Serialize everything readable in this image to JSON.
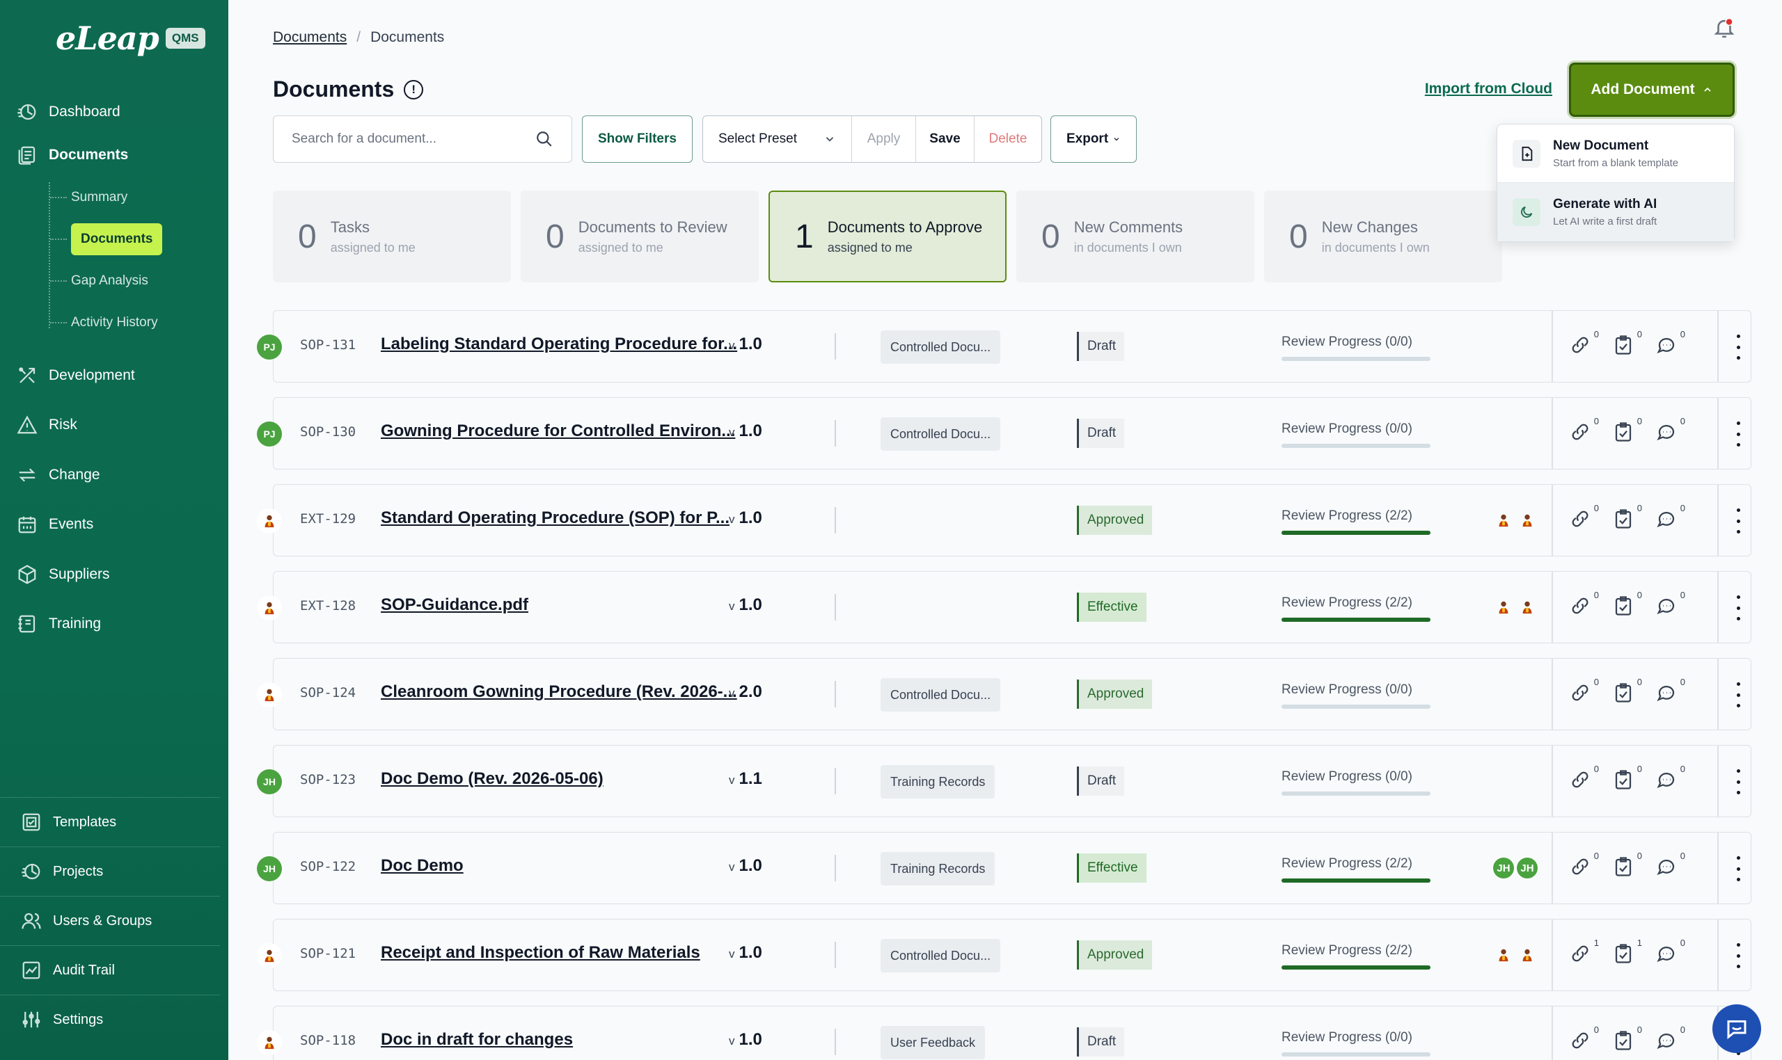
{
  "sidebar": {
    "logo_text": "eLeap",
    "logo_badge": "QMS",
    "nav": [
      {
        "label": "Dashboard",
        "icon": "dashboard-icon"
      },
      {
        "label": "Documents",
        "icon": "documents-icon"
      },
      {
        "label": "Development",
        "icon": "development-icon"
      },
      {
        "label": "Risk",
        "icon": "risk-icon"
      },
      {
        "label": "Change",
        "icon": "change-icon"
      },
      {
        "label": "Events",
        "icon": "calendar-icon"
      },
      {
        "label": "Suppliers",
        "icon": "box-icon"
      },
      {
        "label": "Training",
        "icon": "training-icon"
      }
    ],
    "subnav": [
      {
        "label": "Summary"
      },
      {
        "label": "Documents",
        "active": true
      },
      {
        "label": "Gap Analysis"
      },
      {
        "label": "Activity History"
      }
    ],
    "bottom": [
      {
        "label": "Templates",
        "icon": "templates-icon"
      },
      {
        "label": "Projects",
        "icon": "projects-icon"
      },
      {
        "label": "Users & Groups",
        "icon": "users-icon"
      },
      {
        "label": "Audit Trail",
        "icon": "audit-icon"
      },
      {
        "label": "Settings",
        "icon": "settings-icon"
      }
    ]
  },
  "breadcrumb": {
    "first": "Documents",
    "sep": "/",
    "second": "Documents"
  },
  "page_title": "Documents",
  "import_label": "Import from Cloud",
  "add_label": "Add Document",
  "search_placeholder": "Search for a document...",
  "toolbar": {
    "filters": "Show Filters",
    "preset": "Select Preset",
    "apply": "Apply",
    "save": "Save",
    "delete": "Delete",
    "export": "Export"
  },
  "stats": [
    {
      "num": "0",
      "label": "Tasks",
      "sub": "assigned to me",
      "active": false
    },
    {
      "num": "0",
      "label": "Documents to Review",
      "sub": "assigned to me",
      "active": false
    },
    {
      "num": "1",
      "label": "Documents to Approve",
      "sub": "assigned to me",
      "active": true
    },
    {
      "num": "0",
      "label": "New Comments",
      "sub": "in documents I own",
      "active": false
    },
    {
      "num": "0",
      "label": "New Changes",
      "sub": "in documents I own",
      "active": false
    }
  ],
  "dropdown": [
    {
      "title": "New Document",
      "sub": "Start from a blank template"
    },
    {
      "title": "Generate with AI",
      "sub": "Let AI write a first draft"
    }
  ],
  "rows": [
    {
      "owner": "PJ",
      "id": "SOP-131",
      "title": "Labeling Standard Operating Procedure for...",
      "ver_prefix": "v",
      "ver": "1.0",
      "cat": "Controlled Docu...",
      "status": "Draft",
      "review": "Review Progress (0/0)",
      "progress": 0,
      "reviewers": [],
      "links": "0",
      "tasks": "0",
      "comments": "0"
    },
    {
      "owner": "PJ",
      "id": "SOP-130",
      "title": "Gowning Procedure for Controlled Environ...",
      "ver_prefix": "v",
      "ver": "1.0",
      "cat": "Controlled Docu...",
      "status": "Draft",
      "review": "Review Progress (0/0)",
      "progress": 0,
      "reviewers": [],
      "links": "0",
      "tasks": "0",
      "comments": "0"
    },
    {
      "owner": "",
      "id": "EXT-129",
      "title": "Standard Operating Procedure (SOP) for P...",
      "ver_prefix": "v",
      "ver": "1.0",
      "cat": "",
      "status": "Approved",
      "review": "Review Progress (2/2)",
      "progress": 1,
      "reviewers": [
        "",
        ""
      ],
      "links": "0",
      "tasks": "0",
      "comments": "0"
    },
    {
      "owner": "",
      "id": "EXT-128",
      "title": "SOP-Guidance.pdf",
      "ver_prefix": "v",
      "ver": "1.0",
      "cat": "",
      "status": "Effective",
      "review": "Review Progress (2/2)",
      "progress": 1,
      "reviewers": [
        "",
        ""
      ],
      "links": "0",
      "tasks": "0",
      "comments": "0"
    },
    {
      "owner": "",
      "id": "SOP-124",
      "title": "Cleanroom Gowning Procedure (Rev. 2026-...",
      "ver_prefix": "v",
      "ver": "2.0",
      "cat": "Controlled Docu...",
      "status": "Approved",
      "review": "Review Progress (0/0)",
      "progress": 0,
      "reviewers": [],
      "links": "0",
      "tasks": "0",
      "comments": "0"
    },
    {
      "owner": "JH",
      "id": "SOP-123",
      "title": "Doc Demo (Rev. 2026-05-06)",
      "ver_prefix": "v",
      "ver": "1.1",
      "cat": "Training Records",
      "status": "Draft",
      "review": "Review Progress (0/0)",
      "progress": 0,
      "reviewers": [],
      "links": "0",
      "tasks": "0",
      "comments": "0"
    },
    {
      "owner": "JH",
      "id": "SOP-122",
      "title": "Doc Demo",
      "ver_prefix": "v",
      "ver": "1.0",
      "cat": "Training Records",
      "status": "Effective",
      "review": "Review Progress (2/2)",
      "progress": 1,
      "reviewers": [
        "JH",
        "JH"
      ],
      "links": "0",
      "tasks": "0",
      "comments": "0"
    },
    {
      "owner": "",
      "id": "SOP-121",
      "title": "Receipt and Inspection of Raw Materials",
      "ver_prefix": "v",
      "ver": "1.0",
      "cat": "Controlled Docu...",
      "status": "Approved",
      "review": "Review Progress (2/2)",
      "progress": 1,
      "reviewers": [
        "",
        ""
      ],
      "links": "1",
      "tasks": "1",
      "comments": "0"
    },
    {
      "owner": "",
      "id": "SOP-118",
      "title": "Doc in draft for changes",
      "ver_prefix": "v",
      "ver": "1.0",
      "cat": "User Feedback",
      "status": "Draft",
      "review": "Review Progress (0/0)",
      "progress": 0,
      "reviewers": [],
      "links": "0",
      "tasks": "0",
      "comments": "0"
    }
  ],
  "colors": {
    "sidebar": "#0b6a4e",
    "accent": "#5b8c10",
    "active_pill": "#c6f24e",
    "progress": "#1f6a26"
  }
}
